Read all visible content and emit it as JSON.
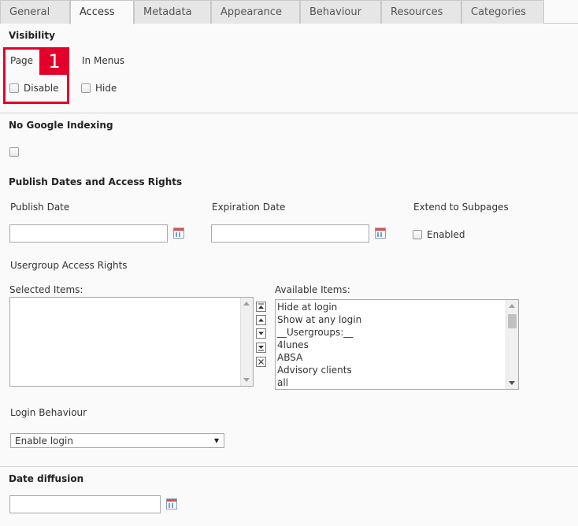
{
  "tabs": [
    {
      "label": "General",
      "active": false
    },
    {
      "label": "Access",
      "active": true
    },
    {
      "label": "Metadata",
      "active": false
    },
    {
      "label": "Appearance",
      "active": false
    },
    {
      "label": "Behaviour",
      "active": false
    },
    {
      "label": "Resources",
      "active": false
    },
    {
      "label": "Categories",
      "active": false
    }
  ],
  "visibility": {
    "title": "Visibility",
    "page_label": "Page",
    "page_checkbox_label": "Disable",
    "page_checked": false,
    "menus_label": "In Menus",
    "menus_checkbox_label": "Hide",
    "menus_checked": false,
    "callout_number": "1",
    "callout_color": "#e4002b"
  },
  "google_indexing": {
    "title": "No Google Indexing",
    "checked": false
  },
  "publish": {
    "title": "Publish Dates and Access Rights",
    "publish_date_label": "Publish Date",
    "publish_date_value": "",
    "expiration_date_label": "Expiration Date",
    "expiration_date_value": "",
    "extend_label": "Extend to Subpages",
    "extend_checkbox_label": "Enabled",
    "extend_checked": false
  },
  "access_rights": {
    "title": "Usergroup Access Rights",
    "selected_label": "Selected Items:",
    "selected_items": [],
    "available_label": "Available Items:",
    "available_items": [
      "Hide at login",
      "Show at any login",
      "__Usergroups:__",
      "4lunes",
      "ABSA",
      "Advisory clients",
      "all"
    ]
  },
  "login_behaviour": {
    "title": "Login Behaviour",
    "selected": "Enable login"
  },
  "date_diffusion": {
    "title": "Date diffusion",
    "value": ""
  },
  "icons": {
    "calendar": "calendar-icon",
    "move_top": "move-top-icon",
    "move_up": "move-up-icon",
    "move_down": "move-down-icon",
    "move_bottom": "move-bottom-icon",
    "remove": "remove-icon"
  }
}
